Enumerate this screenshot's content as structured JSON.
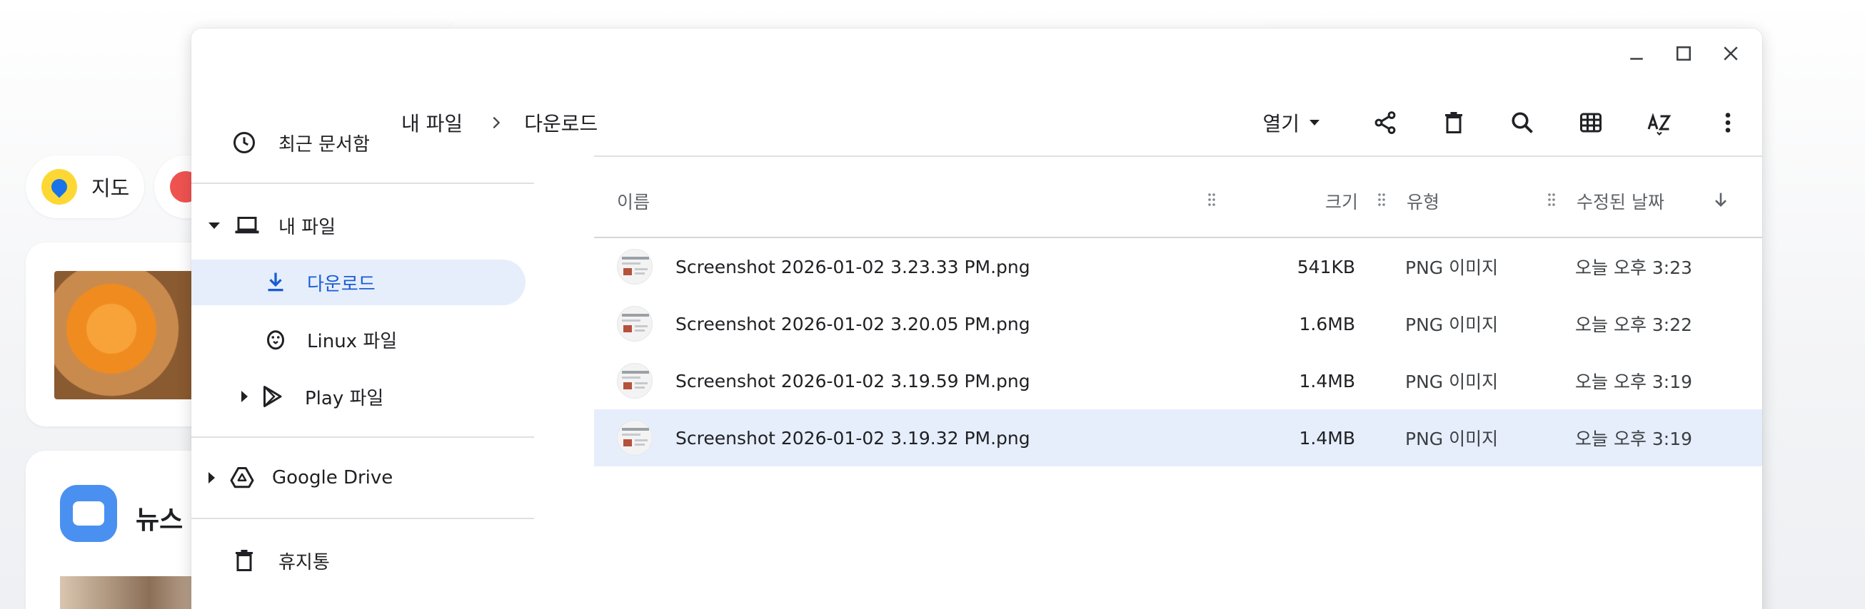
{
  "background": {
    "chip_map_label": "지도",
    "news_label": "뉴스"
  },
  "sidebar": {
    "recent": "최근 문서함",
    "my_files": "내 파일",
    "downloads": "다운로드",
    "linux": "Linux 파일",
    "play": "Play 파일",
    "drive": "Google Drive",
    "trash": "휴지통"
  },
  "breadcrumb": {
    "root": "내 파일",
    "current": "다운로드"
  },
  "toolbar": {
    "open_label": "열기"
  },
  "table": {
    "columns": {
      "name": "이름",
      "size": "크기",
      "type": "유형",
      "modified": "수정된 날짜"
    },
    "rows": [
      {
        "name": "Screenshot 2026-01-02 3.23.33 PM.png",
        "size": "541KB",
        "type": "PNG 이미지",
        "modified": "오늘 오후 3:23",
        "selected": false
      },
      {
        "name": "Screenshot 2026-01-02 3.20.05 PM.png",
        "size": "1.6MB",
        "type": "PNG 이미지",
        "modified": "오늘 오후 3:22",
        "selected": false
      },
      {
        "name": "Screenshot 2026-01-02 3.19.59 PM.png",
        "size": "1.4MB",
        "type": "PNG 이미지",
        "modified": "오늘 오후 3:19",
        "selected": false
      },
      {
        "name": "Screenshot 2026-01-02 3.19.32 PM.png",
        "size": "1.4MB",
        "type": "PNG 이미지",
        "modified": "오늘 오후 3:19",
        "selected": true
      }
    ]
  },
  "colors": {
    "accent": "#1a5cd4",
    "selection": "#e6eefc"
  }
}
